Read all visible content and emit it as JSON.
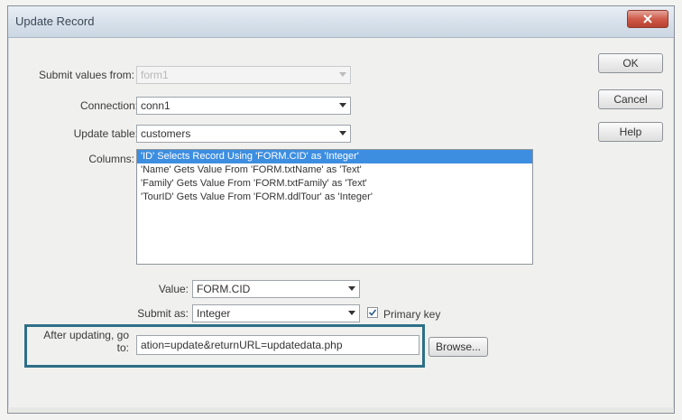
{
  "window": {
    "title": "Update Record"
  },
  "buttons": {
    "ok": "OK",
    "cancel": "Cancel",
    "help": "Help",
    "browse": "Browse..."
  },
  "fields": {
    "submit_values_from": {
      "label": "Submit values from:",
      "value": "form1"
    },
    "connection": {
      "label": "Connection:",
      "value": "conn1"
    },
    "update_table": {
      "label": "Update table:",
      "value": "customers"
    },
    "columns": {
      "label": "Columns:",
      "items": [
        "'ID' Selects Record Using 'FORM.CID' as 'Integer'",
        "'Name' Gets Value From 'FORM.txtName' as 'Text'",
        "'Family' Gets Value From 'FORM.txtFamily' as 'Text'",
        "'TourID' Gets Value From 'FORM.ddlTour' as 'Integer'"
      ],
      "selected_index": 0
    },
    "value": {
      "label": "Value:",
      "value": "FORM.CID"
    },
    "submit_as": {
      "label": "Submit as:",
      "value": "Integer"
    },
    "primary_key": {
      "label": "Primary key",
      "checked": true
    },
    "after_updating": {
      "label_line1": "After updating, go",
      "label_line2": "to:",
      "value": "ation=update&returnURL=updatedata.php"
    }
  },
  "colors": {
    "highlight_border": "#2d6f88",
    "selected_row": "#3d8ee0",
    "close_button": "#cf5b4a"
  }
}
